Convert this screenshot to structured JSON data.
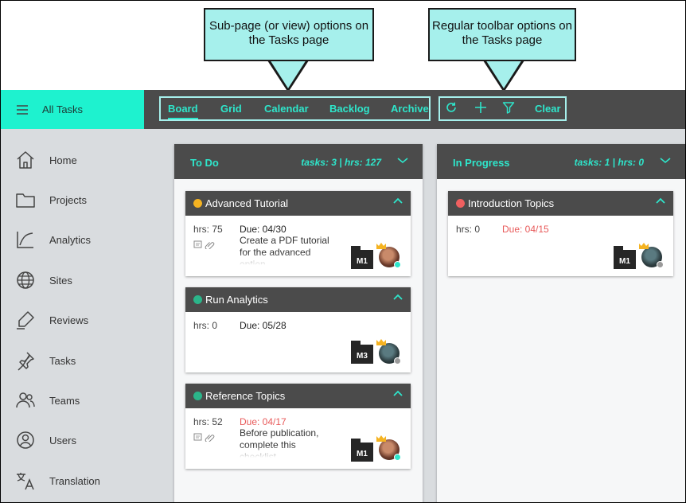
{
  "callouts": {
    "subpage": "Sub-page (or view) options on the Tasks page",
    "toolbar": "Regular toolbar options on the Tasks page"
  },
  "app": {
    "title": "All Tasks",
    "accent": "#1ef2cf",
    "highlight": "#2ee6cb"
  },
  "tabs": [
    {
      "label": "Board",
      "active": true
    },
    {
      "label": "Grid"
    },
    {
      "label": "Calendar"
    },
    {
      "label": "Backlog"
    },
    {
      "label": "Archive"
    }
  ],
  "toolbar": {
    "refresh_icon": "refresh-icon",
    "add_icon": "plus-icon",
    "filter_icon": "filter-icon",
    "clear_label": "Clear"
  },
  "sidebar": {
    "items": [
      {
        "label": "Home",
        "icon": "home-icon"
      },
      {
        "label": "Projects",
        "icon": "folder-icon"
      },
      {
        "label": "Analytics",
        "icon": "analytics-icon"
      },
      {
        "label": "Sites",
        "icon": "globe-icon"
      },
      {
        "label": "Reviews",
        "icon": "pen-icon"
      },
      {
        "label": "Tasks",
        "icon": "pin-icon"
      },
      {
        "label": "Teams",
        "icon": "team-icon"
      },
      {
        "label": "Users",
        "icon": "user-icon"
      },
      {
        "label": "Translation",
        "icon": "translate-icon"
      }
    ]
  },
  "columns": [
    {
      "title": "To Do",
      "stats": "tasks: 3 | hrs: 127",
      "cards": [
        {
          "title": "Advanced Tutorial",
          "dot_color": "#f5b321",
          "hrs": "hrs: 75",
          "due": "Due: 04/30",
          "late": false,
          "description": "Create a PDF tutorial for the advanced option",
          "has_icons": true,
          "badge": "M1",
          "avatar_status": "#2ee6cb"
        },
        {
          "title": "Run Analytics",
          "dot_color": "#2bb58a",
          "hrs": "hrs: 0",
          "due": "Due: 05/28",
          "late": false,
          "description": "",
          "has_icons": false,
          "badge": "M3",
          "avatar_status": "#9a9a9a"
        },
        {
          "title": "Reference Topics",
          "dot_color": "#2bb58a",
          "hrs": "hrs: 52",
          "due": "Due: 04/17",
          "late": true,
          "description": "Before publication, complete this checklist",
          "has_icons": true,
          "badge": "M1",
          "avatar_status": "#2ee6cb"
        }
      ]
    },
    {
      "title": "In Progress",
      "stats": "tasks: 1 | hrs: 0",
      "cards": [
        {
          "title": "Introduction Topics",
          "dot_color": "#f06060",
          "hrs": "hrs: 0",
          "due": "Due: 04/15",
          "late": true,
          "description": "",
          "has_icons": false,
          "badge": "M1",
          "avatar_status": "#9a9a9a"
        }
      ]
    }
  ]
}
